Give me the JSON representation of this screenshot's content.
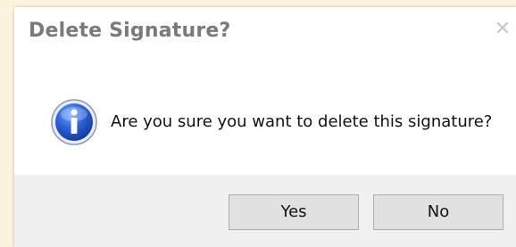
{
  "dialog": {
    "title": "Delete Signature?",
    "close_glyph": "✕",
    "message": "Are you sure you want to delete this signature?",
    "icon": "information-icon",
    "buttons": {
      "yes_label": "Yes",
      "no_label": "No"
    }
  },
  "colors": {
    "desktop_background": "#fbf3dc",
    "title_text": "#7a7a7a",
    "footer_background": "#f0f0f0",
    "button_background": "#e1e1e1",
    "icon_blue": "#1f4fbf"
  }
}
